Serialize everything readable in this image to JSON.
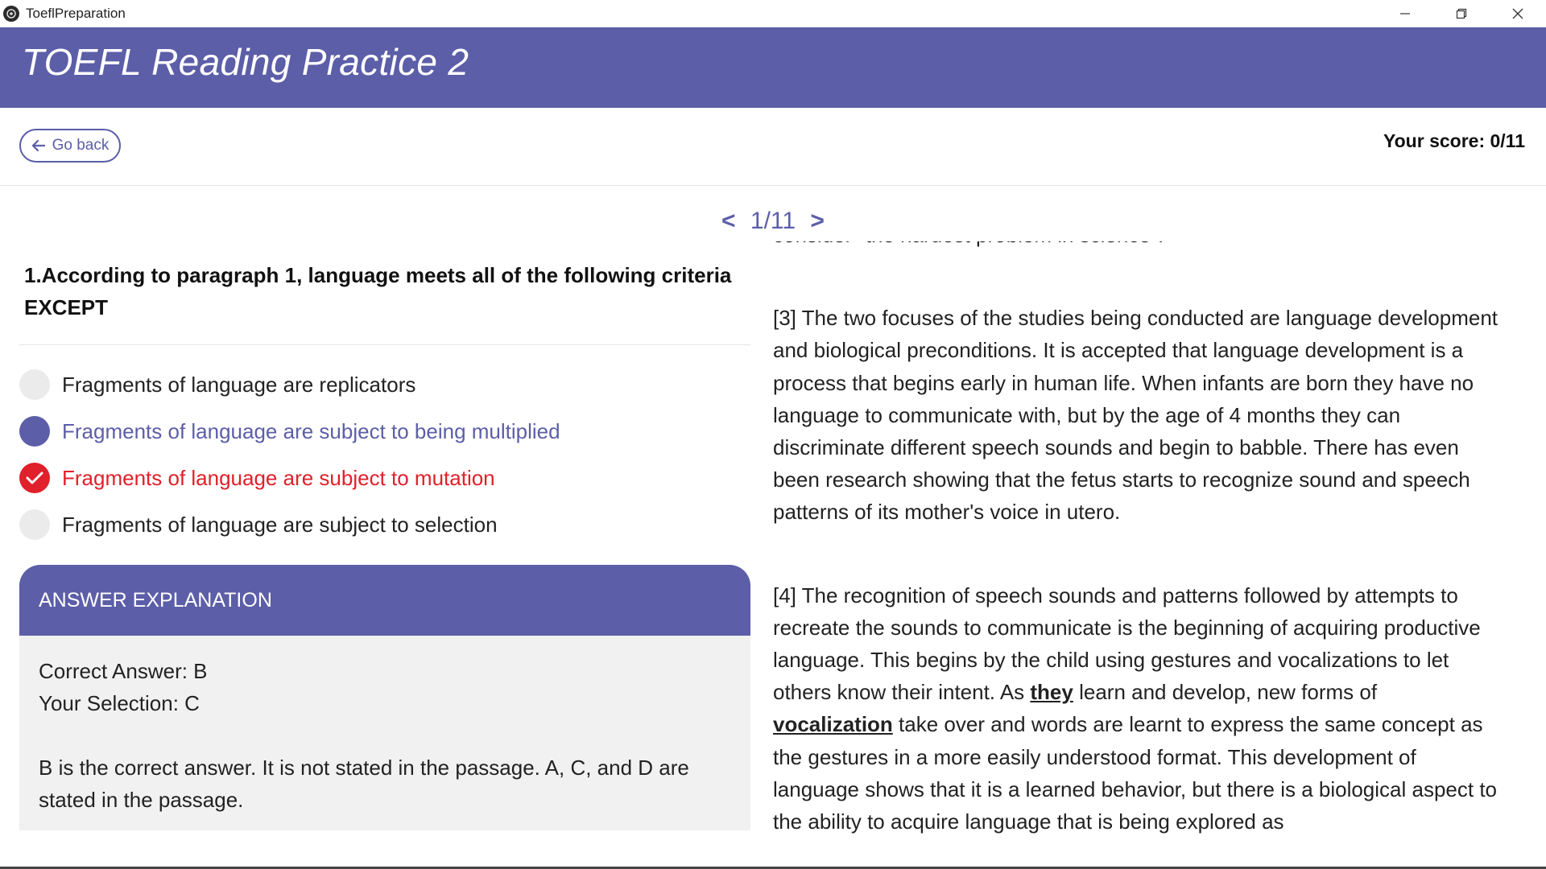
{
  "window": {
    "app_title": "ToeflPreparation",
    "minimize_glyph": "—",
    "restore_glyph": "❐",
    "close_glyph": "✕"
  },
  "header": {
    "title": "TOEFL Reading Practice 2"
  },
  "toolbar": {
    "go_back_label": "Go back",
    "score_text": "Your score: 0/11"
  },
  "pager": {
    "prev": "<",
    "current": "1/11",
    "next": ">"
  },
  "question": {
    "text": "1.According to paragraph 1, language meets all of the following criteria EXCEPT",
    "options": [
      {
        "label": "Fragments of language are replicators",
        "state": "none"
      },
      {
        "label": "Fragments of language are subject to being multiplied",
        "state": "correct"
      },
      {
        "label": "Fragments of language are subject to mutation",
        "state": "wrong"
      },
      {
        "label": "Fragments of language are subject to selection",
        "state": "none"
      }
    ]
  },
  "explanation": {
    "header": "ANSWER EXPLANATION",
    "correct_answer": "Correct Answer: B",
    "your_selection": "Your Selection: C",
    "detail": "B is the correct answer. It is not stated in the passage. A, C, and D are stated in the passage."
  },
  "passage": {
    "partial_line": "consider \"the hardest problem in science\".",
    "para3": "[3]  The two focuses of the studies being conducted are language development and biological preconditions.  It is accepted that language development is a process that begins early in human life.  When infants are born they have no language to communicate with, but by the age of 4 months they can discriminate different speech sounds and begin to babble.  There has even been research showing that the fetus starts to recognize sound and speech patterns of its mother's voice in utero.",
    "para4_a": "[4]  The recognition of speech sounds and patterns followed by attempts to recreate the sounds to communicate is the beginning of acquiring productive language.  This begins by the child using gestures and vocalizations to let others know their intent. As ",
    "para4_kw1": "they",
    "para4_b": " learn and develop, new forms of ",
    "para4_kw2": "vocalization",
    "para4_c": " take over and words are learnt to express the same concept as the gestures in a more easily understood format. This development of language shows that it is a learned behavior, but there is a biological aspect to the ability to acquire language that is being explored as"
  },
  "colors": {
    "brand": "#5c5ea8",
    "wrong": "#e0202a",
    "panel_bg": "#f1f1f1"
  }
}
